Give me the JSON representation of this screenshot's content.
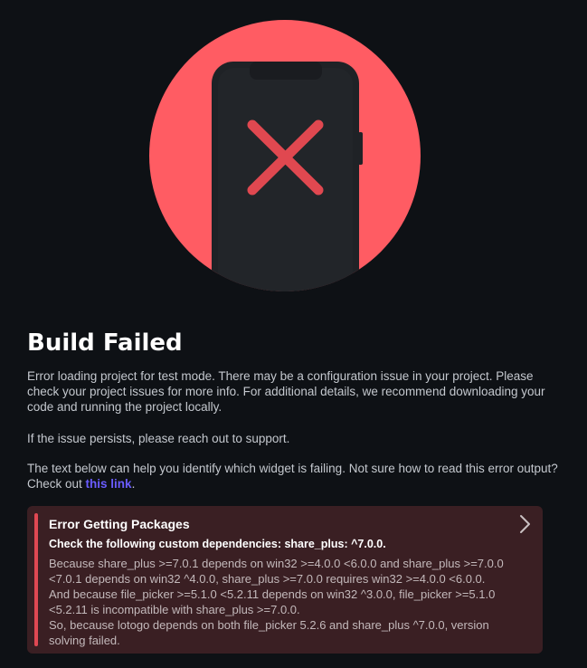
{
  "illustration": {
    "icon": "phone-error-icon",
    "circle_color": "#ff5c63",
    "phone_color": "#1f2226",
    "x_color": "#e04850"
  },
  "page": {
    "title": "Build Failed",
    "description": "Error loading project for test mode. There may be a configuration issue in your project. Please check your project issues for more info. For additional details, we recommend downloading your code and running the project locally.",
    "support_note": "If the issue persists, please reach out to support.",
    "help_text": "The text below can help you identify which widget is failing. Not sure how to read this error output? Check out ",
    "help_link": "this link",
    "help_suffix": "."
  },
  "error": {
    "title": "Error Getting Packages",
    "subtitle": "Check the following custom dependencies: share_plus: ^7.0.0.",
    "lines": [
      "Because share_plus >=7.0.1 depends on win32 >=4.0.0 <6.0.0 and share_plus >=7.0.0 <7.0.1 depends on win32 ^4.0.0, share_plus >=7.0.0 requires win32 >=4.0.0 <6.0.0.",
      "And because file_picker >=5.1.0 <5.2.11 depends on win32 ^3.0.0, file_picker >=5.1.0 <5.2.11 is incompatible with share_plus >=7.0.0.",
      "So, because lotogo depends on both file_picker 5.2.6 and share_plus ^7.0.0, version solving failed."
    ],
    "accent_color": "#e04853",
    "background_color": "#3a1f23",
    "expand_icon": "chevron-right-icon"
  }
}
